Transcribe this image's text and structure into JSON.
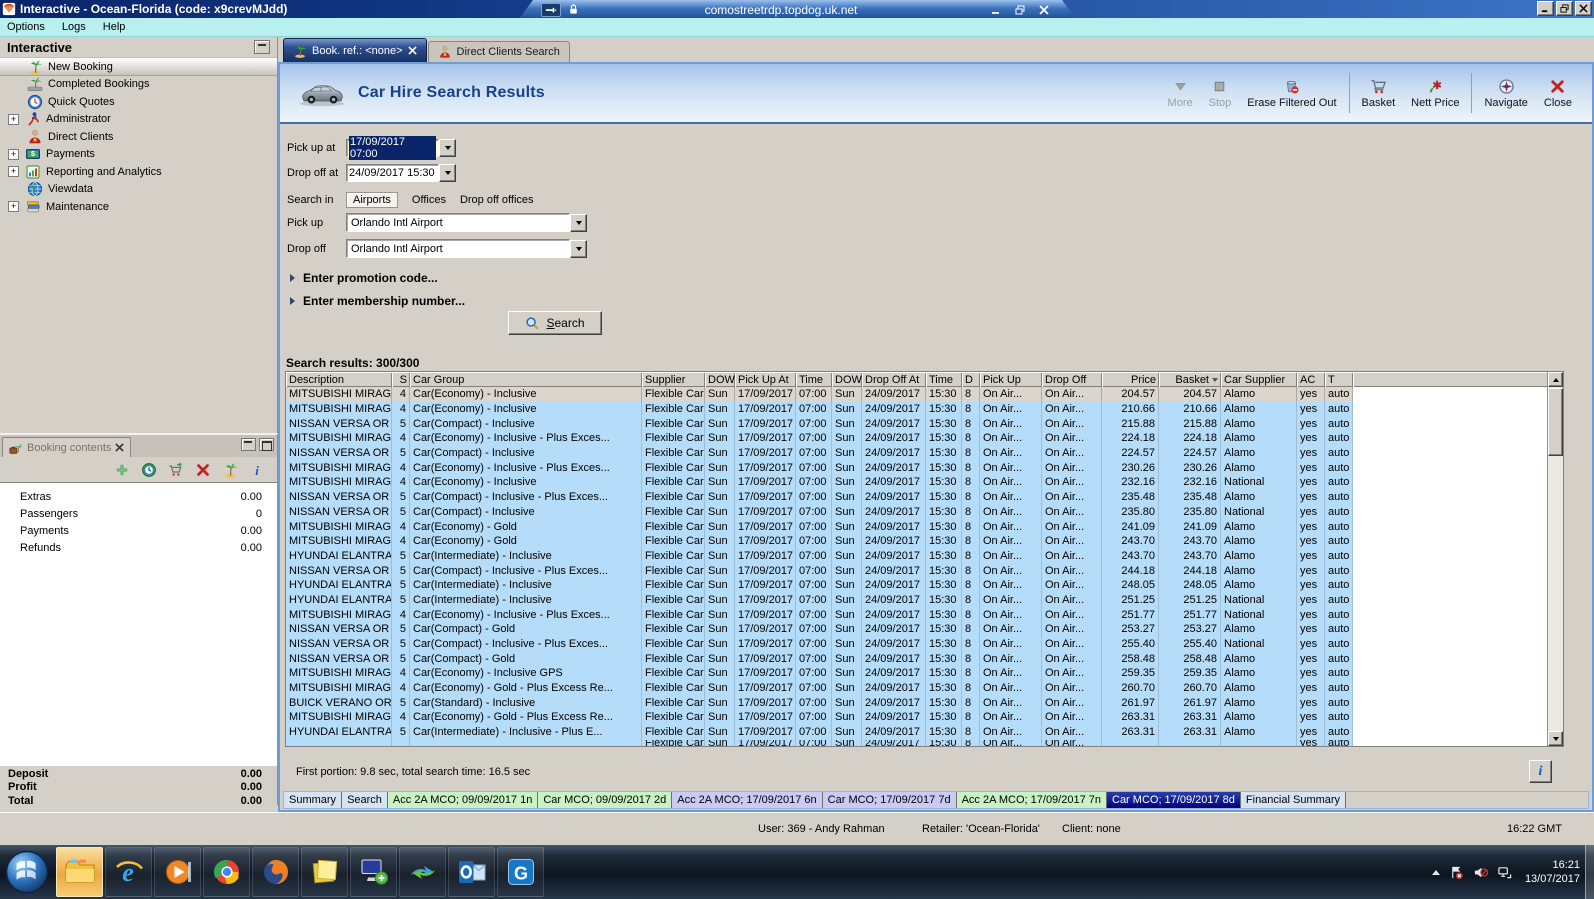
{
  "window": {
    "title": "Interactive - Ocean-Florida (code: x9crevMJdd)",
    "menu": [
      "Options",
      "Logs",
      "Help"
    ]
  },
  "rdp_bar": {
    "host": "comostreetrdp.topdog.uk.net"
  },
  "sidebar": {
    "title": "Interactive",
    "items": [
      {
        "label": "New Booking",
        "icon": "palm-tree-icon",
        "expandable": false,
        "selected": true
      },
      {
        "label": "Completed Bookings",
        "icon": "completed-bookings-icon",
        "expandable": false,
        "selected": false
      },
      {
        "label": "Quick Quotes",
        "icon": "clock-icon",
        "expandable": false,
        "selected": false
      },
      {
        "label": "Administrator",
        "icon": "administrator-icon",
        "expandable": true,
        "selected": false
      },
      {
        "label": "Direct Clients",
        "icon": "person-icon",
        "expandable": false,
        "selected": false
      },
      {
        "label": "Payments",
        "icon": "payments-icon",
        "expandable": true,
        "selected": false
      },
      {
        "label": "Reporting and Analytics",
        "icon": "reporting-icon",
        "expandable": true,
        "selected": false
      },
      {
        "label": "Viewdata",
        "icon": "globe-icon",
        "expandable": false,
        "selected": false
      },
      {
        "label": "Maintenance",
        "icon": "maintenance-icon",
        "expandable": true,
        "selected": false
      }
    ]
  },
  "booking_contents": {
    "tab_title": "Booking contents",
    "toolbar_icons": [
      "plus-icon",
      "globe-clock-icon",
      "cart-arrow-icon",
      "red-x-icon",
      "palm-tree-icon",
      "info-icon"
    ],
    "rows": [
      {
        "label": "Extras",
        "value": "0.00"
      },
      {
        "label": "Passengers",
        "value": "0"
      },
      {
        "label": "Payments",
        "value": "0.00"
      },
      {
        "label": "Refunds",
        "value": "0.00"
      }
    ],
    "summary": [
      {
        "label": "Deposit",
        "value": "0.00"
      },
      {
        "label": "Profit",
        "value": "0.00"
      },
      {
        "label": "Total",
        "value": "0.00"
      }
    ]
  },
  "main": {
    "tabs": [
      {
        "label": "Book. ref.: <none>",
        "icon": "palm-tree-icon",
        "active": true,
        "closable": true
      },
      {
        "label": "Direct Clients Search",
        "icon": "person-icon",
        "active": false,
        "closable": false
      }
    ],
    "header": {
      "title": "Car Hire Search Results"
    },
    "toolbar": [
      {
        "label": "More",
        "icon": "more-icon",
        "disabled": true,
        "sep_after": false
      },
      {
        "label": "Stop",
        "icon": "stop-icon",
        "disabled": true,
        "sep_after": false
      },
      {
        "label": "Erase Filtered Out",
        "icon": "erase-icon",
        "disabled": false,
        "sep_after": true
      },
      {
        "label": "Basket",
        "icon": "basket-icon",
        "disabled": false,
        "sep_after": false
      },
      {
        "label": "Nett Price",
        "icon": "nett-price-icon",
        "disabled": false,
        "sep_after": true
      },
      {
        "label": "Navigate",
        "icon": "navigate-icon",
        "disabled": false,
        "sep_after": false
      },
      {
        "label": "Close",
        "icon": "close-red-icon",
        "disabled": false,
        "sep_after": false
      }
    ],
    "form": {
      "pickup_at_label": "Pick up at",
      "pickup_at_value": "17/09/2017 07:00",
      "dropoff_at_label": "Drop off at",
      "dropoff_at_value": "24/09/2017 15:30",
      "search_in_label": "Search in",
      "search_in_options": [
        {
          "label": "Airports",
          "selected": true
        },
        {
          "label": "Offices",
          "selected": false
        },
        {
          "label": "Drop off offices",
          "selected": false
        }
      ],
      "pickup_label": "Pick up",
      "pickup_value": "Orlando Intl Airport",
      "dropoff_label": "Drop off",
      "dropoff_value": "Orlando Intl Airport",
      "promo_toggle": "Enter promotion code...",
      "membership_toggle": "Enter membership number...",
      "search_button": "Search"
    },
    "results_label": "Search results: 300/300",
    "table": {
      "columns": [
        "Description",
        "S",
        "Car Group",
        "Supplier",
        "DOW",
        "Pick Up At",
        "Time",
        "DOW",
        "Drop Off At",
        "Time",
        "D",
        "Pick Up",
        "Drop Off",
        "Price",
        "Basket",
        "Car Supplier",
        "AC",
        "T",
        ""
      ],
      "sort_column": "Basket",
      "shared": {
        "supplier": "Flexible Car...",
        "dow": "Sun",
        "pick_up_at": "17/09/2017",
        "time": "07:00",
        "dow2": "Sun",
        "drop_off_at": "24/09/2017",
        "time2": "15:30",
        "d": "8",
        "pick_up": "On Air...",
        "drop_off": "On Air...",
        "ac": "yes",
        "t": "auto"
      },
      "rows": [
        {
          "description": "MITSUBISHI MIRAGE...",
          "s": "4",
          "car_group": "Car(Economy) - Inclusive",
          "price": "204.57",
          "basket": "204.57",
          "car_supplier": "Alamo",
          "selected": true
        },
        {
          "description": "MITSUBISHI MIRAGE...",
          "s": "4",
          "car_group": "Car(Economy) - Inclusive",
          "price": "210.66",
          "basket": "210.66",
          "car_supplier": "Alamo",
          "selected": false
        },
        {
          "description": "NISSAN VERSA OR S...",
          "s": "5",
          "car_group": "Car(Compact) - Inclusive",
          "price": "215.88",
          "basket": "215.88",
          "car_supplier": "Alamo",
          "selected": false
        },
        {
          "description": "MITSUBISHI MIRAGE...",
          "s": "4",
          "car_group": "Car(Economy) - Inclusive - Plus Exces...",
          "price": "224.18",
          "basket": "224.18",
          "car_supplier": "Alamo",
          "selected": false
        },
        {
          "description": "NISSAN VERSA OR S...",
          "s": "5",
          "car_group": "Car(Compact) - Inclusive",
          "price": "224.57",
          "basket": "224.57",
          "car_supplier": "Alamo",
          "selected": false
        },
        {
          "description": "MITSUBISHI MIRAGE...",
          "s": "4",
          "car_group": "Car(Economy) - Inclusive - Plus Exces...",
          "price": "230.26",
          "basket": "230.26",
          "car_supplier": "Alamo",
          "selected": false
        },
        {
          "description": "MITSUBISHI MIRAGE...",
          "s": "4",
          "car_group": "Car(Economy) - Inclusive",
          "price": "232.16",
          "basket": "232.16",
          "car_supplier": "National",
          "selected": false
        },
        {
          "description": "NISSAN VERSA OR S...",
          "s": "5",
          "car_group": "Car(Compact) - Inclusive - Plus Exces...",
          "price": "235.48",
          "basket": "235.48",
          "car_supplier": "Alamo",
          "selected": false
        },
        {
          "description": "NISSAN VERSA OR S...",
          "s": "5",
          "car_group": "Car(Compact) - Inclusive",
          "price": "235.80",
          "basket": "235.80",
          "car_supplier": "National",
          "selected": false
        },
        {
          "description": "MITSUBISHI MIRAGE...",
          "s": "4",
          "car_group": "Car(Economy) - Gold",
          "price": "241.09",
          "basket": "241.09",
          "car_supplier": "Alamo",
          "selected": false
        },
        {
          "description": "MITSUBISHI MIRAGE...",
          "s": "4",
          "car_group": "Car(Economy) - Gold",
          "price": "243.70",
          "basket": "243.70",
          "car_supplier": "Alamo",
          "selected": false
        },
        {
          "description": "HYUNDAI ELANTRA ...",
          "s": "5",
          "car_group": "Car(Intermediate) - Inclusive",
          "price": "243.70",
          "basket": "243.70",
          "car_supplier": "Alamo",
          "selected": false
        },
        {
          "description": "NISSAN VERSA OR S...",
          "s": "5",
          "car_group": "Car(Compact) - Inclusive - Plus Exces...",
          "price": "244.18",
          "basket": "244.18",
          "car_supplier": "Alamo",
          "selected": false
        },
        {
          "description": "HYUNDAI ELANTRA ...",
          "s": "5",
          "car_group": "Car(Intermediate) - Inclusive",
          "price": "248.05",
          "basket": "248.05",
          "car_supplier": "Alamo",
          "selected": false
        },
        {
          "description": "HYUNDAI ELANTRA ...",
          "s": "5",
          "car_group": "Car(Intermediate) - Inclusive",
          "price": "251.25",
          "basket": "251.25",
          "car_supplier": "National",
          "selected": false
        },
        {
          "description": "MITSUBISHI MIRAGE...",
          "s": "4",
          "car_group": "Car(Economy) - Inclusive - Plus Exces...",
          "price": "251.77",
          "basket": "251.77",
          "car_supplier": "National",
          "selected": false
        },
        {
          "description": "NISSAN VERSA OR S...",
          "s": "5",
          "car_group": "Car(Compact) - Gold",
          "price": "253.27",
          "basket": "253.27",
          "car_supplier": "Alamo",
          "selected": false
        },
        {
          "description": "NISSAN VERSA OR S...",
          "s": "5",
          "car_group": "Car(Compact) - Inclusive - Plus Exces...",
          "price": "255.40",
          "basket": "255.40",
          "car_supplier": "National",
          "selected": false
        },
        {
          "description": "NISSAN VERSA OR S...",
          "s": "5",
          "car_group": "Car(Compact) - Gold",
          "price": "258.48",
          "basket": "258.48",
          "car_supplier": "Alamo",
          "selected": false
        },
        {
          "description": "MITSUBISHI MIRAGE...",
          "s": "4",
          "car_group": "Car(Economy) - Inclusive GPS",
          "price": "259.35",
          "basket": "259.35",
          "car_supplier": "Alamo",
          "selected": false
        },
        {
          "description": "MITSUBISHI MIRAGE...",
          "s": "4",
          "car_group": "Car(Economy) - Gold - Plus Excess Re...",
          "price": "260.70",
          "basket": "260.70",
          "car_supplier": "Alamo",
          "selected": false
        },
        {
          "description": "BUICK VERANO OR S...",
          "s": "5",
          "car_group": "Car(Standard) - Inclusive",
          "price": "261.97",
          "basket": "261.97",
          "car_supplier": "Alamo",
          "selected": false
        },
        {
          "description": "MITSUBISHI MIRAGE...",
          "s": "4",
          "car_group": "Car(Economy) - Gold - Plus Excess Re...",
          "price": "263.31",
          "basket": "263.31",
          "car_supplier": "Alamo",
          "selected": false
        },
        {
          "description": "HYUNDAI ELANTRA ...",
          "s": "5",
          "car_group": "Car(Intermediate) - Inclusive - Plus E...",
          "price": "263.31",
          "basket": "263.31",
          "car_supplier": "Alamo",
          "selected": false
        }
      ]
    },
    "status_line": "First portion: 9.8 sec, total search time: 16.5 sec",
    "info_button": "i",
    "bottom_tabs": [
      {
        "label": "Summary",
        "color": "plain"
      },
      {
        "label": "Search",
        "color": "plain"
      },
      {
        "label": "Acc 2A MCO; 09/09/2017 1n",
        "color": "green"
      },
      {
        "label": "Car MCO; 09/09/2017 2d",
        "color": "green"
      },
      {
        "label": "Acc 2A MCO; 17/09/2017 6n",
        "color": "lavender"
      },
      {
        "label": "Car MCO; 17/09/2017 7d",
        "color": "lavender"
      },
      {
        "label": "Acc 2A MCO; 17/09/2017 7n",
        "color": "green"
      },
      {
        "label": "Car MCO; 17/09/2017 8d",
        "color": "navy"
      },
      {
        "label": "Financial Summary",
        "color": "plain"
      }
    ]
  },
  "status_bar": {
    "user": "User: 369 - Andy Rahman",
    "retailer": "Retailer: 'Ocean-Florida'",
    "client": "Client: none",
    "gmt_time": "16:22 GMT"
  },
  "taskbar": {
    "icons": [
      "start",
      "explorer",
      "internet-explorer",
      "media-player",
      "chrome",
      "firefox",
      "sticky-notes",
      "remote-desktop",
      "sync-app",
      "outlook",
      "g-app"
    ],
    "tray_time": "16:21",
    "tray_date": "13/07/2017"
  },
  "colors": {
    "title_bar": "#0a246a",
    "menu_bar": "#b7f0ee",
    "panel": "#d4d0c8",
    "row_blue": "#b5dcf8",
    "row_selected": "#dad6ce",
    "header_title": "#16418c",
    "tab_green": "#c8f2c4",
    "tab_lavender": "#c9cbf5",
    "tab_navy": "#000080",
    "highlight_yellow": "#ffffc4",
    "selection_navy": "#0a246a"
  }
}
